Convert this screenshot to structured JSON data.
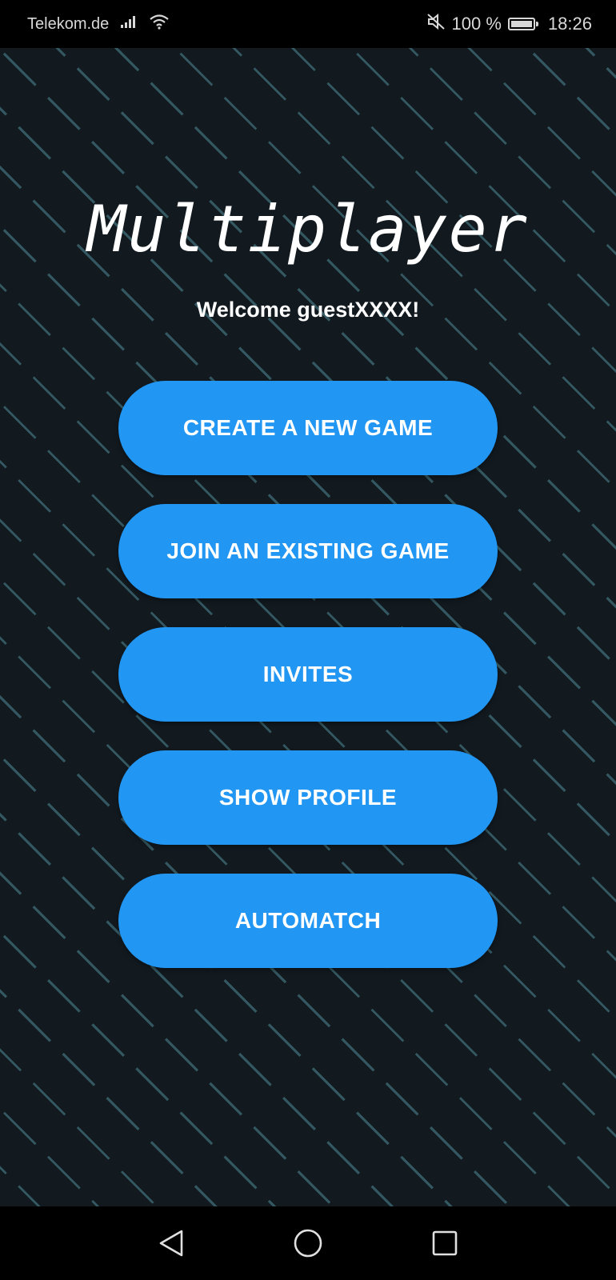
{
  "status_bar": {
    "carrier": "Telekom.de",
    "battery_percent": "100 %",
    "battery_level": 1.0,
    "time": "18:26",
    "icons": [
      "signal-icon",
      "wifi-icon",
      "mute-icon",
      "battery-icon"
    ]
  },
  "screen": {
    "title": "Multiplayer",
    "welcome": "Welcome guestXXXX!",
    "buttons": [
      "CREATE A NEW GAME",
      "JOIN AN EXISTING GAME",
      "INVITES",
      "SHOW PROFILE",
      "AUTOMATCH"
    ],
    "button_color": "#2196f3",
    "background_color": "#121a20"
  },
  "nav_bar": {
    "icons": [
      "back-icon",
      "home-icon",
      "recents-icon"
    ]
  }
}
